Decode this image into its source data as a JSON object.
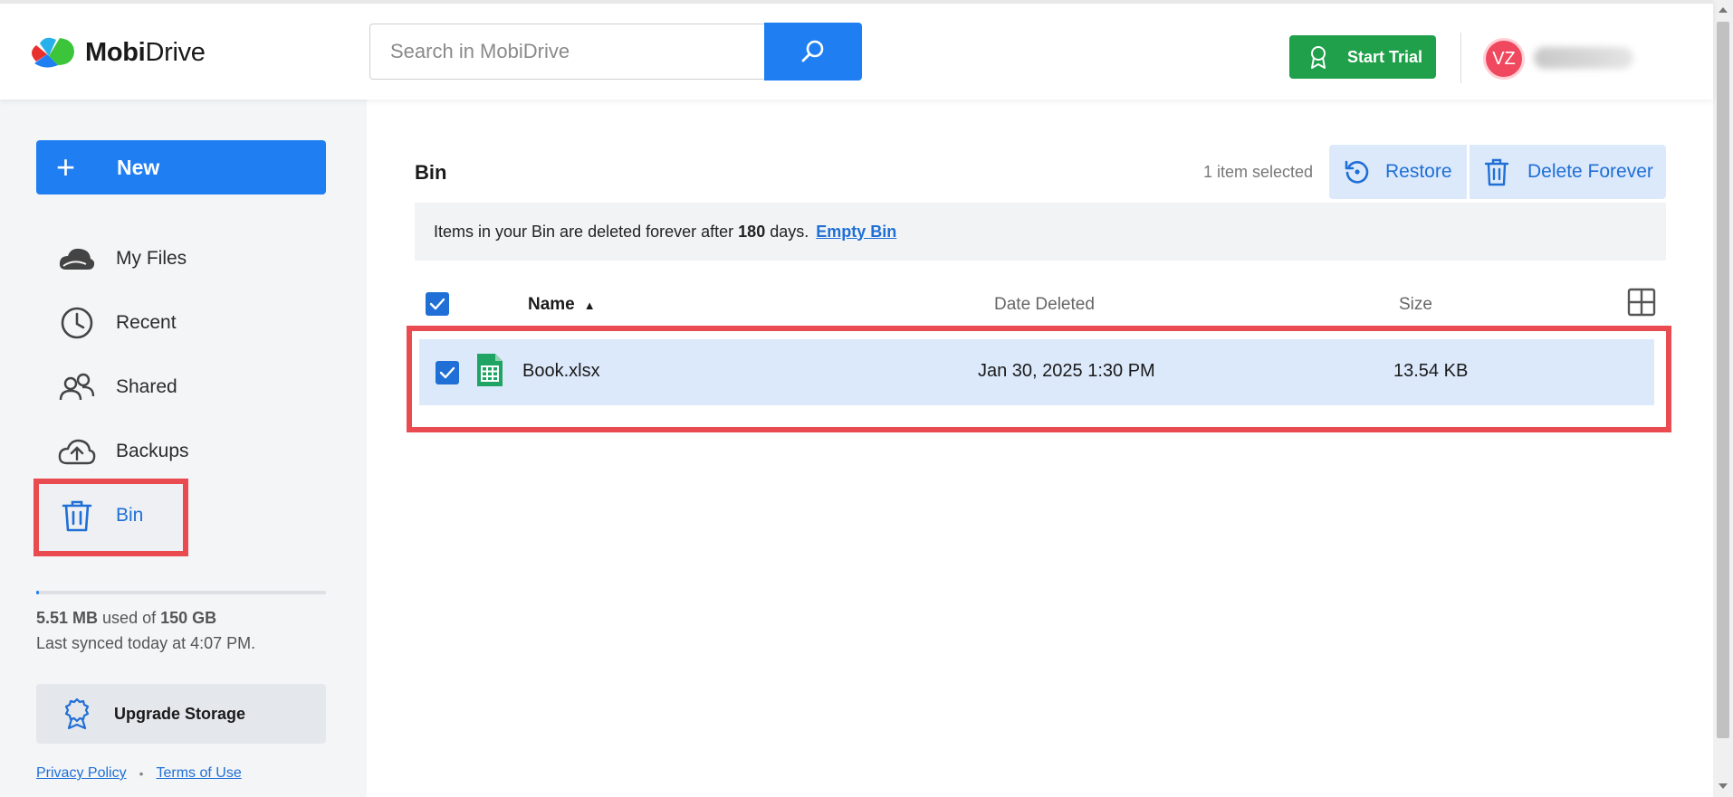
{
  "app": {
    "logo_bold": "Mobi",
    "logo_light": "Drive"
  },
  "header": {
    "search_placeholder": "Search in MobiDrive",
    "start_trial_label": "Start Trial",
    "avatar_initials": "VZ"
  },
  "sidebar": {
    "new_label": "New",
    "plus_glyph": "+",
    "items": [
      {
        "label": "My Files",
        "icon": "cloud-icon"
      },
      {
        "label": "Recent",
        "icon": "clock-icon"
      },
      {
        "label": "Shared",
        "icon": "users-icon"
      },
      {
        "label": "Backups",
        "icon": "cloud-upload-icon"
      },
      {
        "label": "Bin",
        "icon": "trash-icon",
        "active": true
      }
    ],
    "storage": {
      "used": "5.51 MB",
      "used_of": "used of",
      "total": "150 GB",
      "used_fraction": 0.0001,
      "last_synced": "Last synced today at 4:07 PM."
    },
    "upgrade_label": "Upgrade Storage",
    "privacy_label": "Privacy Policy",
    "separator": "•",
    "terms_label": "Terms of Use"
  },
  "main": {
    "title": "Bin",
    "selected_count": "1 item selected",
    "restore_label": "Restore",
    "delete_forever_label": "Delete Forever",
    "banner": {
      "text_before": "Items in your Bin are deleted forever after",
      "days": "180",
      "text_after": "days.",
      "empty_bin_label": "Empty Bin"
    },
    "columns": {
      "name": "Name",
      "sort_glyph": "▲",
      "date_deleted": "Date Deleted",
      "size": "Size"
    },
    "files": [
      {
        "name": "Book.xlsx",
        "date_deleted": "Jan 30, 2025 1:30 PM",
        "size": "13.54 KB",
        "selected": true,
        "icon": "spreadsheet-icon"
      }
    ]
  },
  "colors": {
    "accent": "#1f7ff2",
    "trial": "#20a04a",
    "highlight": "#e94b50",
    "avatar": "#f0485e",
    "selected_row": "#dce9fb"
  }
}
